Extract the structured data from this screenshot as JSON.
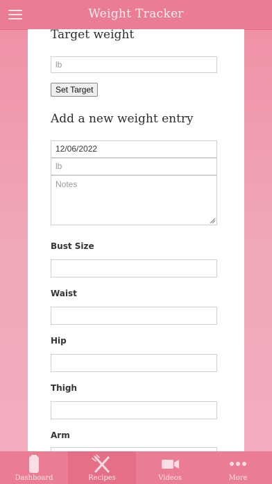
{
  "header": {
    "title": "Weight Tracker",
    "menu_icon": "hamburger-menu-icon"
  },
  "target": {
    "title": "Target weight",
    "placeholder": "lb",
    "button_label": "Set Target"
  },
  "entry": {
    "title": "Add a new weight entry",
    "date_value": "12/06/2022",
    "weight_placeholder": "lb",
    "notes_placeholder": "Notes"
  },
  "measurements": [
    {
      "label": "Bust Size"
    },
    {
      "label": "Waist"
    },
    {
      "label": "Hip"
    },
    {
      "label": "Thigh"
    },
    {
      "label": "Arm"
    }
  ],
  "nav": {
    "active": "Recipes",
    "items": [
      {
        "label": "Dashboard",
        "icon": "clipboard-icon"
      },
      {
        "label": "Recipes",
        "icon": "fork-knife-icon"
      },
      {
        "label": "Videos",
        "icon": "video-camera-icon"
      },
      {
        "label": "More",
        "icon": "more-dots-icon"
      }
    ]
  },
  "colors": {
    "accent": "#ea7d93",
    "background": "#f0a7b7",
    "card": "#ffffff"
  }
}
